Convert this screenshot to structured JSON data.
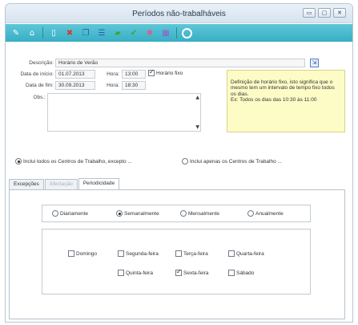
{
  "window": {
    "title": "Períodos não-trabalháveis",
    "controls": [
      "restore-icon",
      "maximize-icon",
      "close-icon"
    ]
  },
  "toolbar": {
    "icons": [
      "wrench-icon",
      "home-icon",
      "new-document-icon",
      "delete-icon",
      "copy-icon",
      "list-icon",
      "folder-icon",
      "check-icon",
      "search-icon",
      "calendar-icon",
      "refresh-icon"
    ]
  },
  "form": {
    "descricao_label": "Descrição:",
    "descricao_value": "Horário de Verão",
    "inicio_label": "Data de início:",
    "inicio_value": "01.07.2013",
    "hora_label": "Hora:",
    "hora_inicio_value": "13:00",
    "horario_fixo_label": "Horário fixo",
    "fim_label": "Data de fim:",
    "fim_value": "30.09.2013",
    "hora_fim_value": "18:30",
    "obs_label": "Obs.:",
    "hint": "Definição de horário fixo, isto significa que o mesmo tem um intervalo de tempo fixo todos os dias.\nEx: Todos os dias das 10:30 às 11:00"
  },
  "scope": {
    "option1": "Inclui todos os Centros de Trabalho, excepto ...",
    "option2": "Inclui apenas os Centros de Trabalho ..."
  },
  "tabs": [
    "Excepções",
    "Afectação",
    "Periodicidade"
  ],
  "periodicity": {
    "options": [
      "Diariamente",
      "Semanalmente",
      "Mensalmente",
      "Anualmente"
    ],
    "selected": "Semanalmente"
  },
  "days": {
    "row1": [
      "Domingo",
      "Segunda-feira",
      "Terça-feira",
      "Quarta-feira"
    ],
    "row2": [
      "Quinta-feira",
      "Sexta-feira",
      "Sábado"
    ],
    "checked": [
      "Sexta-feira"
    ]
  }
}
